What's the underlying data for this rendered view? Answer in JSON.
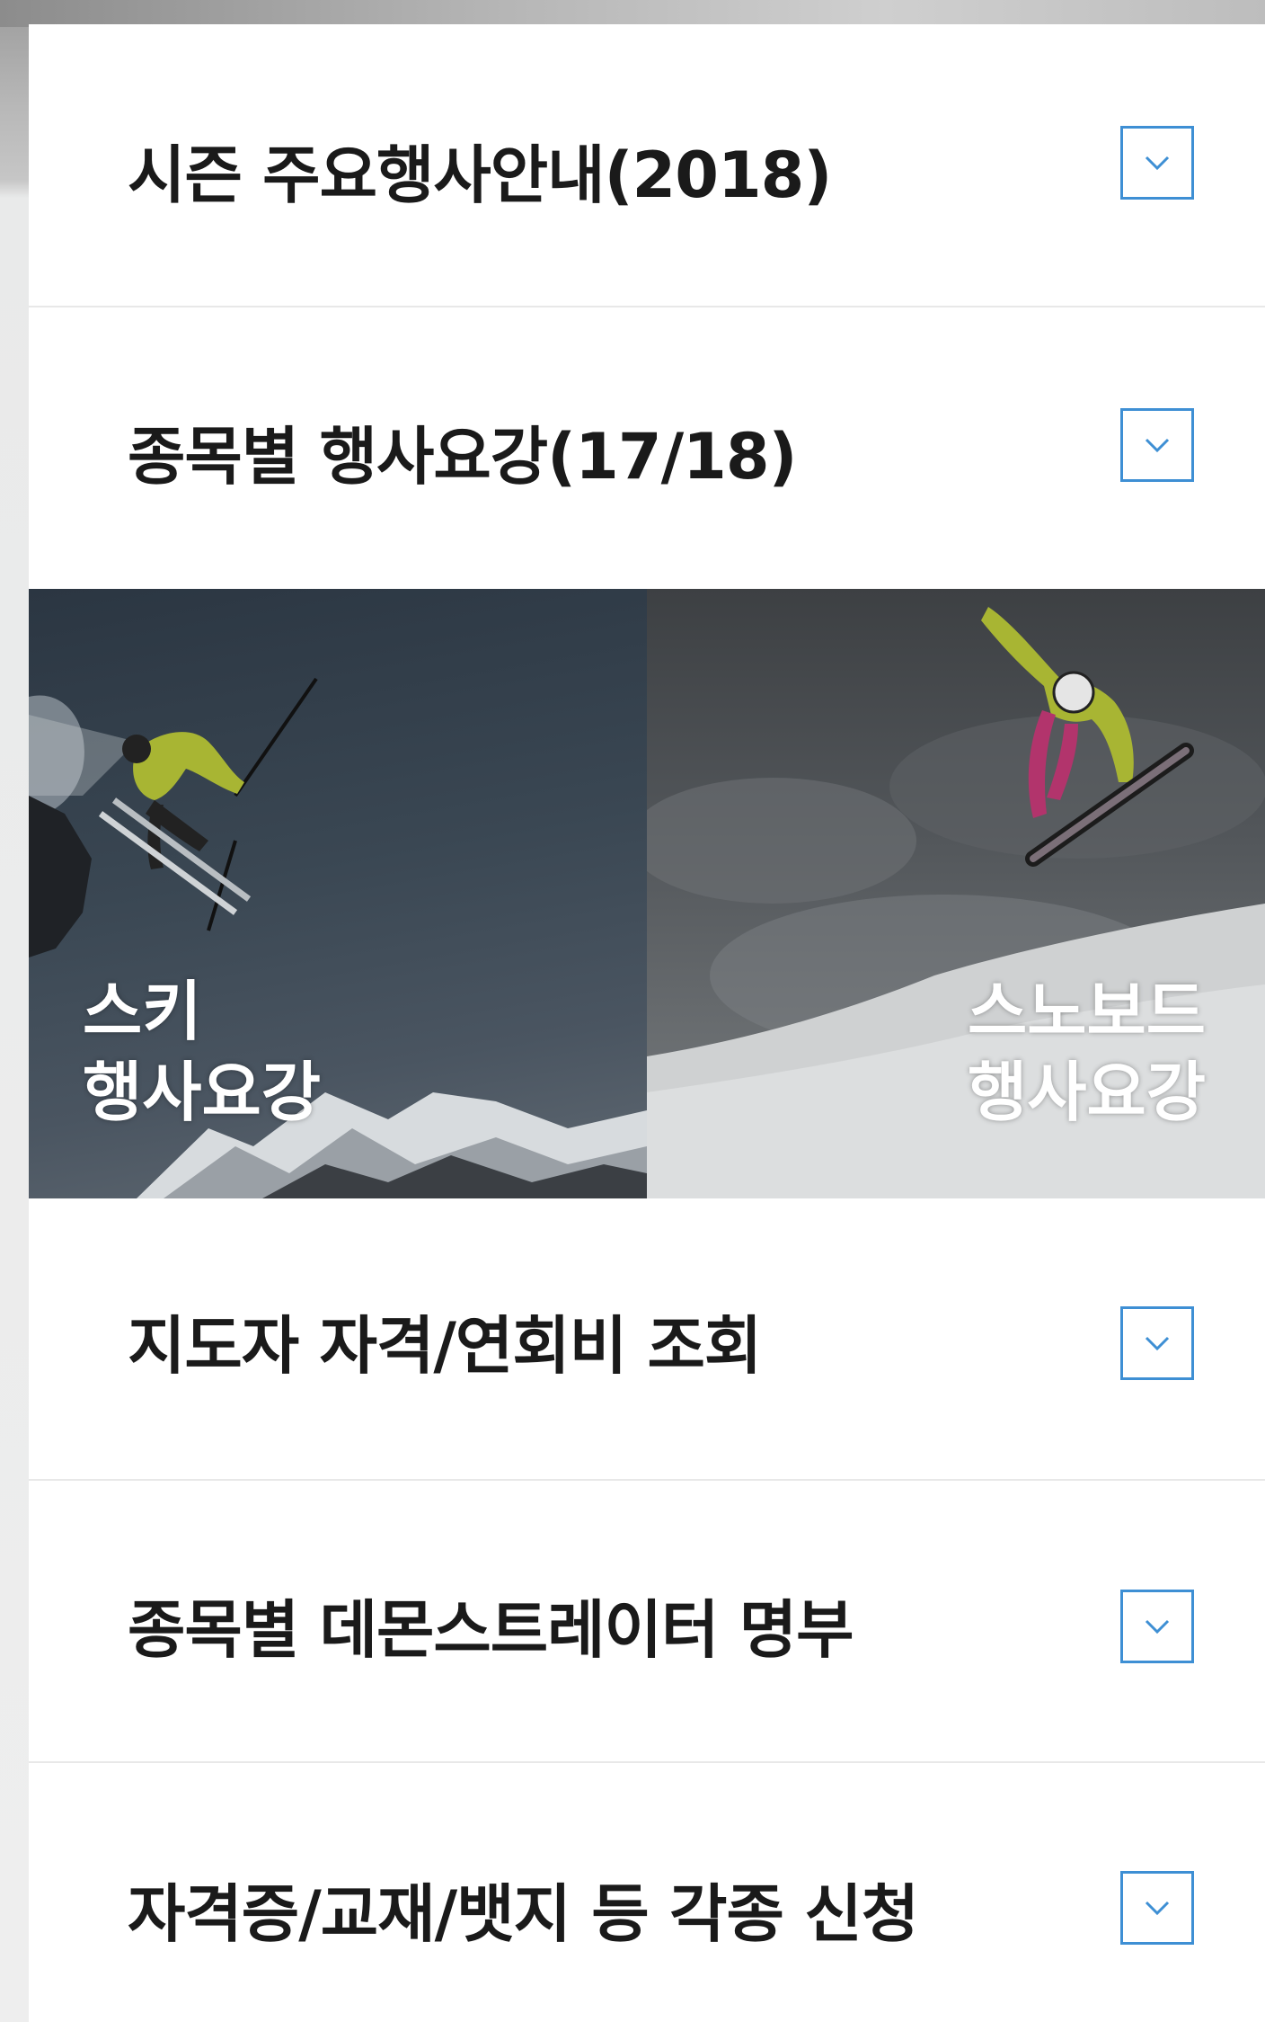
{
  "menu": {
    "items": [
      {
        "label": "시즌 주요행사안내(2018)",
        "toggle_icon": "chevron-down-icon"
      },
      {
        "label": "종목별 행사요강(17/18)",
        "toggle_icon": "chevron-down-icon"
      },
      {
        "label": "지도자 자격/연회비 조회",
        "toggle_icon": "chevron-down-icon"
      },
      {
        "label": "종목별 데몬스트레이터 명부",
        "toggle_icon": "chevron-down-icon"
      },
      {
        "label": "자격증/교재/뱃지 등 각종 신청",
        "toggle_icon": "chevron-down-icon"
      }
    ]
  },
  "banners": {
    "ski": {
      "line1": "스키",
      "line2": "행사요강"
    },
    "snowboard": {
      "line1": "스노보드",
      "line2": "행사요강"
    }
  },
  "colors": {
    "accent": "#3e8fd4",
    "text": "#1a1a1a",
    "divider": "#e8e8e8"
  }
}
